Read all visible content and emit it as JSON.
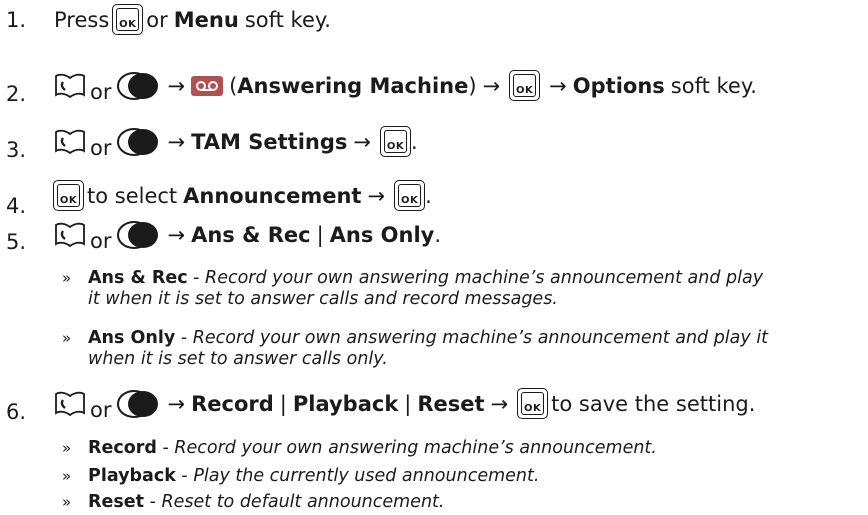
{
  "steps": [
    {
      "num": "1.",
      "parts": {
        "a": "Press",
        "b": "or",
        "c": "Menu",
        "d": "soft key."
      }
    },
    {
      "num": "2.",
      "parts": {
        "or": "or",
        "arrow1": "→",
        "open": "(",
        "bold": "Answering Machine",
        "close": ")",
        "arrow2": "→",
        "arrow3": "→",
        "opt": "Options",
        "end": "soft key."
      }
    },
    {
      "num": "3.",
      "parts": {
        "or": "or",
        "arrow1": "→",
        "bold": "TAM Settings",
        "arrow2": "→",
        "dot": "."
      }
    },
    {
      "num": "4.",
      "parts": {
        "a": "to select",
        "bold": "Announcement",
        "arrow": "→",
        "dot": "."
      }
    },
    {
      "num": "5.",
      "parts": {
        "or": "or",
        "arrow": "→",
        "b1": "Ans & Rec",
        "sep": "|",
        "b2": "Ans Only",
        "dot": "."
      }
    },
    {
      "num": "6.",
      "parts": {
        "or": "or",
        "arrow1": "→",
        "b1": "Record",
        "sep1": "|",
        "b2": "Playback",
        "sep2": "|",
        "b3": "Reset",
        "arrow2": "→",
        "end": "to save the setting."
      }
    }
  ],
  "ok_key_label": "OK",
  "bullet": "»",
  "step5_sub": [
    {
      "term": "Ans & Rec",
      "dash": " - ",
      "l1": "Record your own answering machine’s announcement and play",
      "l2": "it when it is set to answer calls and record messages."
    },
    {
      "term": "Ans Only",
      "dash": " - ",
      "l1": "Record your own answering machine’s announcement and play it",
      "l2": "when it is set to answer calls only."
    }
  ],
  "step6_sub": [
    {
      "term": "Record",
      "dash": " - ",
      "l1": "Record your own answering machine’s announcement."
    },
    {
      "term": "Playback",
      "dash": " - ",
      "l1": "Play the currently used announcement."
    },
    {
      "term": "Reset",
      "dash": " - ",
      "l1": "Reset to default announcement."
    }
  ],
  "colors": {
    "text": "#1b1b1b",
    "tam_icon": "#ad5151"
  },
  "icons": {
    "phonebook": "phonebook-icon",
    "dial": "navigation-dial-icon",
    "tam": "answering-machine-icon",
    "ok": "ok-key-icon"
  }
}
